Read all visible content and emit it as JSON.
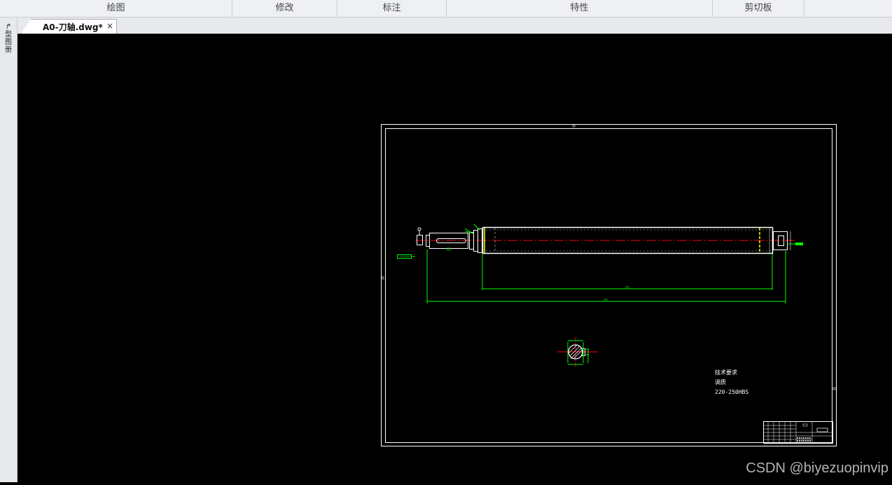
{
  "ribbon": {
    "sections": [
      "绘图",
      "修改",
      "标注",
      "特性",
      "剪切板"
    ]
  },
  "left_strip": {
    "tool_labels": [
      "↱",
      "型",
      "图",
      "册"
    ]
  },
  "tab": {
    "title": "A0-刀轴.dwg*",
    "close": "×"
  },
  "drawing": {
    "notes": {
      "heading": "技术要求",
      "line1": "调质",
      "line2": "220-250HBS"
    }
  },
  "watermark": "CSDN @biyezuopinvip",
  "colors": {
    "ribbon_bg": "#eef0f3",
    "canvas_bg": "#000000",
    "frame": "#ffffff",
    "dimension": "#00ff00",
    "centerline": "#ff0000",
    "part_outline": "#ffffff",
    "highlight": "#ffff00"
  }
}
